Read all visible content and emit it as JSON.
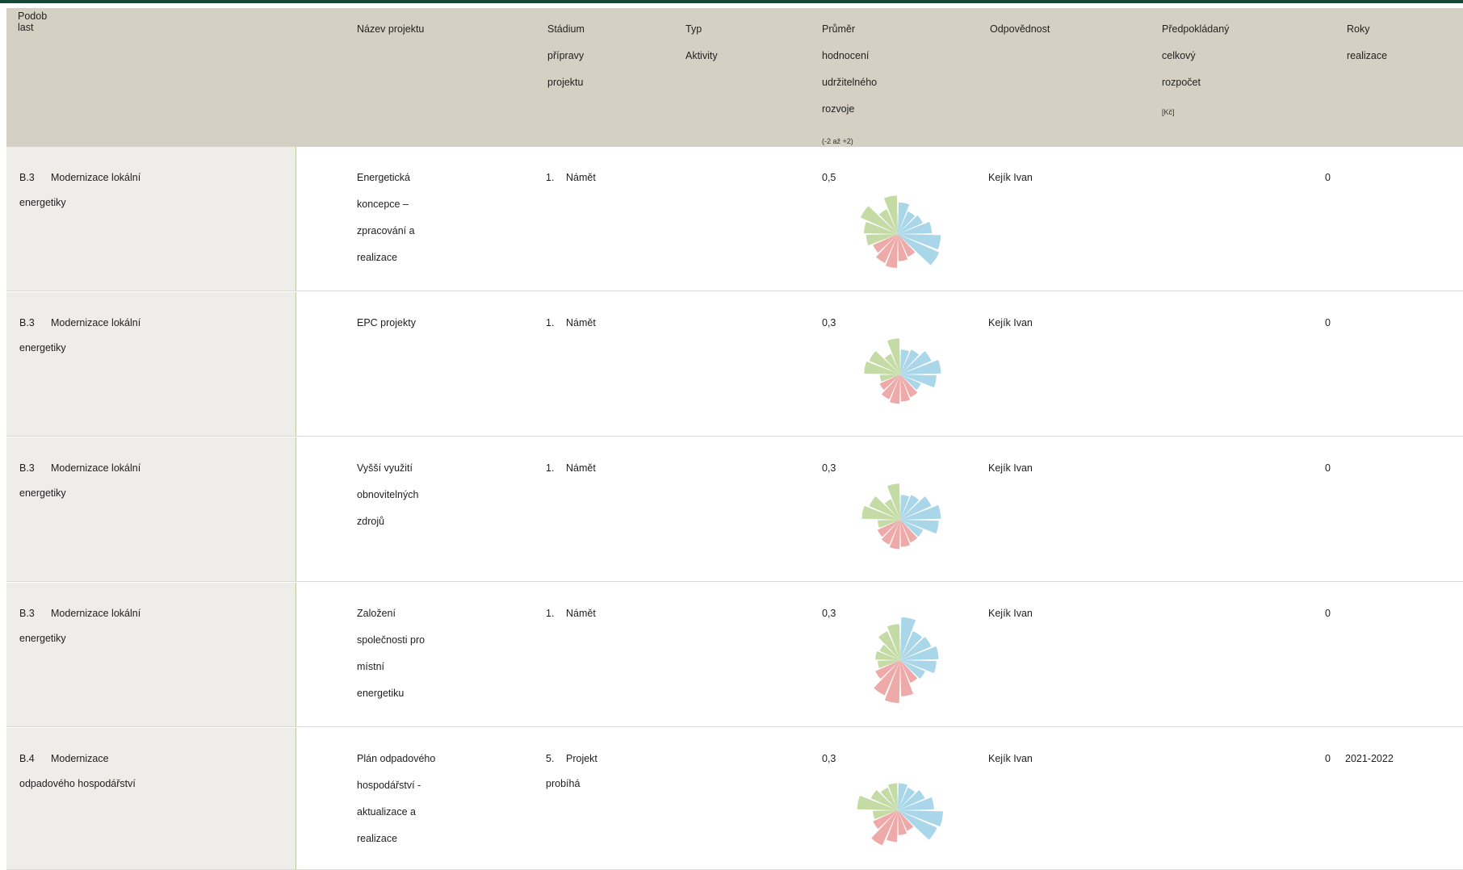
{
  "colors": {
    "header_bg": "#d4d0c3",
    "top_bar": "#14493a",
    "left_cell_bg": "#eeedea",
    "rose_green": "#c5dba6",
    "rose_blue": "#a9d6e8",
    "rose_red": "#eeaaa9"
  },
  "header": {
    "podoblast": [
      "Podob",
      "last"
    ],
    "nazev": "Název projektu",
    "stadium": [
      "Stádium",
      "přípravy",
      "projektu"
    ],
    "typ": [
      "Typ",
      "Aktivity"
    ],
    "prumer": [
      "Průměr",
      "hodnocení",
      "udržitelného",
      "rozvoje"
    ],
    "prumer_range": "(-2 až +2)",
    "odpovednost": "Odpovědnost",
    "rozpocet": [
      "Předpokládaný",
      "celkový",
      "rozpočet"
    ],
    "rozpocet_unit": "[Kč]",
    "roky": [
      "Roky",
      "realizace"
    ]
  },
  "rows": [
    {
      "code": "B.3",
      "area": [
        "Modernizace lokální",
        "energetiky"
      ],
      "name": [
        "Energetická",
        "koncepce –",
        "zpracování a",
        "realizace"
      ],
      "stage_num": "1.",
      "stage": [
        "Námět"
      ],
      "rating": "0,5",
      "responsible": "Kejík Ivan",
      "budget": "0",
      "years": "",
      "rose": [
        0.7,
        0.55,
        0.6,
        0.75,
        0.95,
        1.0,
        0.55,
        0.6,
        0.75,
        0.7,
        0.6,
        0.7,
        0.75,
        0.9,
        0.6,
        0.85
      ]
    },
    {
      "code": "B.3",
      "area": [
        "Modernizace lokální",
        "energetiky"
      ],
      "name": [
        "EPC projekty"
      ],
      "stage_num": "1.",
      "stage": [
        "Námět"
      ],
      "rating": "0,3",
      "responsible": "Kejík Ivan",
      "budget": "0",
      "years": "",
      "rose": [
        0.55,
        0.6,
        0.75,
        0.9,
        0.8,
        0.5,
        0.55,
        0.6,
        0.65,
        0.6,
        0.5,
        0.45,
        0.8,
        0.75,
        0.5,
        0.8
      ]
    },
    {
      "code": "B.3",
      "area": [
        "Modernizace lokální",
        "energetiky"
      ],
      "name": [
        "Vyšší využití",
        "obnovitelných",
        "zdrojů"
      ],
      "stage_num": "1.",
      "stage": [
        "Námět"
      ],
      "rating": "0,3",
      "responsible": "Kejík Ivan",
      "budget": "0",
      "years": "",
      "rose": [
        0.55,
        0.6,
        0.75,
        0.9,
        0.85,
        0.55,
        0.55,
        0.6,
        0.65,
        0.6,
        0.55,
        0.5,
        0.85,
        0.75,
        0.5,
        0.8
      ]
    },
    {
      "code": "B.3",
      "area": [
        "Modernizace lokální",
        "energetiky"
      ],
      "name": [
        "Založení",
        "společnosti pro",
        "místní",
        "energetiku"
      ],
      "stage_num": "1.",
      "stage": [
        "Námět"
      ],
      "rating": "0,3",
      "responsible": "Kejík Ivan",
      "budget": "0",
      "years": "",
      "rose": [
        0.95,
        0.7,
        0.75,
        0.85,
        0.8,
        0.6,
        0.55,
        0.8,
        0.95,
        0.85,
        0.6,
        0.5,
        0.55,
        0.5,
        0.7,
        0.8
      ]
    },
    {
      "code": "B.4",
      "area": [
        "Modernizace",
        "odpadového hospodářství"
      ],
      "name": [
        "Plán odpadového",
        "hospodářství -",
        "aktualizace a",
        "realizace"
      ],
      "stage_num": "5.",
      "stage": [
        "Projekt",
        "probíhá"
      ],
      "rating": "0,3",
      "responsible": "Kejík Ivan",
      "budget": "0",
      "years": "2021-2022",
      "rose": [
        0.6,
        0.55,
        0.65,
        0.8,
        1.0,
        0.95,
        0.5,
        0.55,
        0.7,
        0.85,
        0.6,
        0.55,
        0.9,
        0.65,
        0.55,
        0.6
      ]
    }
  ]
}
